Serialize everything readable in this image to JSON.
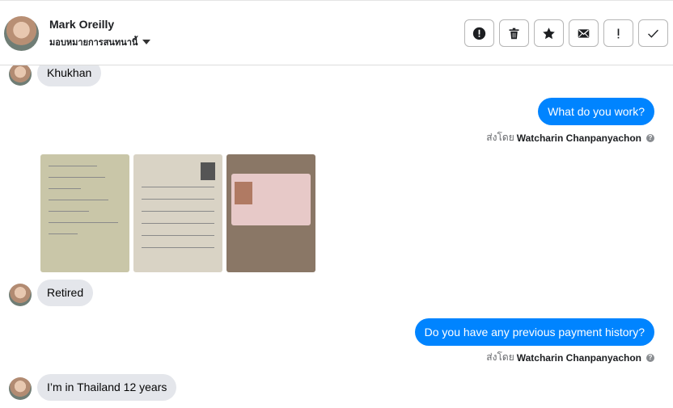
{
  "header": {
    "name": "Mark Oreilly",
    "assign_label": "มอบหมายการสนทนานี้"
  },
  "actions": [
    {
      "name": "report-button",
      "icon": "alert-circle-icon"
    },
    {
      "name": "delete-button",
      "icon": "trash-icon"
    },
    {
      "name": "star-button",
      "icon": "star-icon"
    },
    {
      "name": "mark-unread-button",
      "icon": "envelope-icon"
    },
    {
      "name": "important-button",
      "icon": "exclamation-icon"
    },
    {
      "name": "done-button",
      "icon": "check-icon"
    }
  ],
  "messages": {
    "m1": "Khukhan",
    "m2": "What do you work?",
    "m3": "Retired",
    "m4": "Do you have any previous payment history?",
    "m5": "I’m in Thailand 12 years"
  },
  "sent_by": {
    "prefix": "ส่งโดย",
    "agent": "Watcharin Chanpanyachon"
  },
  "colors": {
    "outgoing": "#0084ff",
    "incoming": "#e4e6eb"
  }
}
